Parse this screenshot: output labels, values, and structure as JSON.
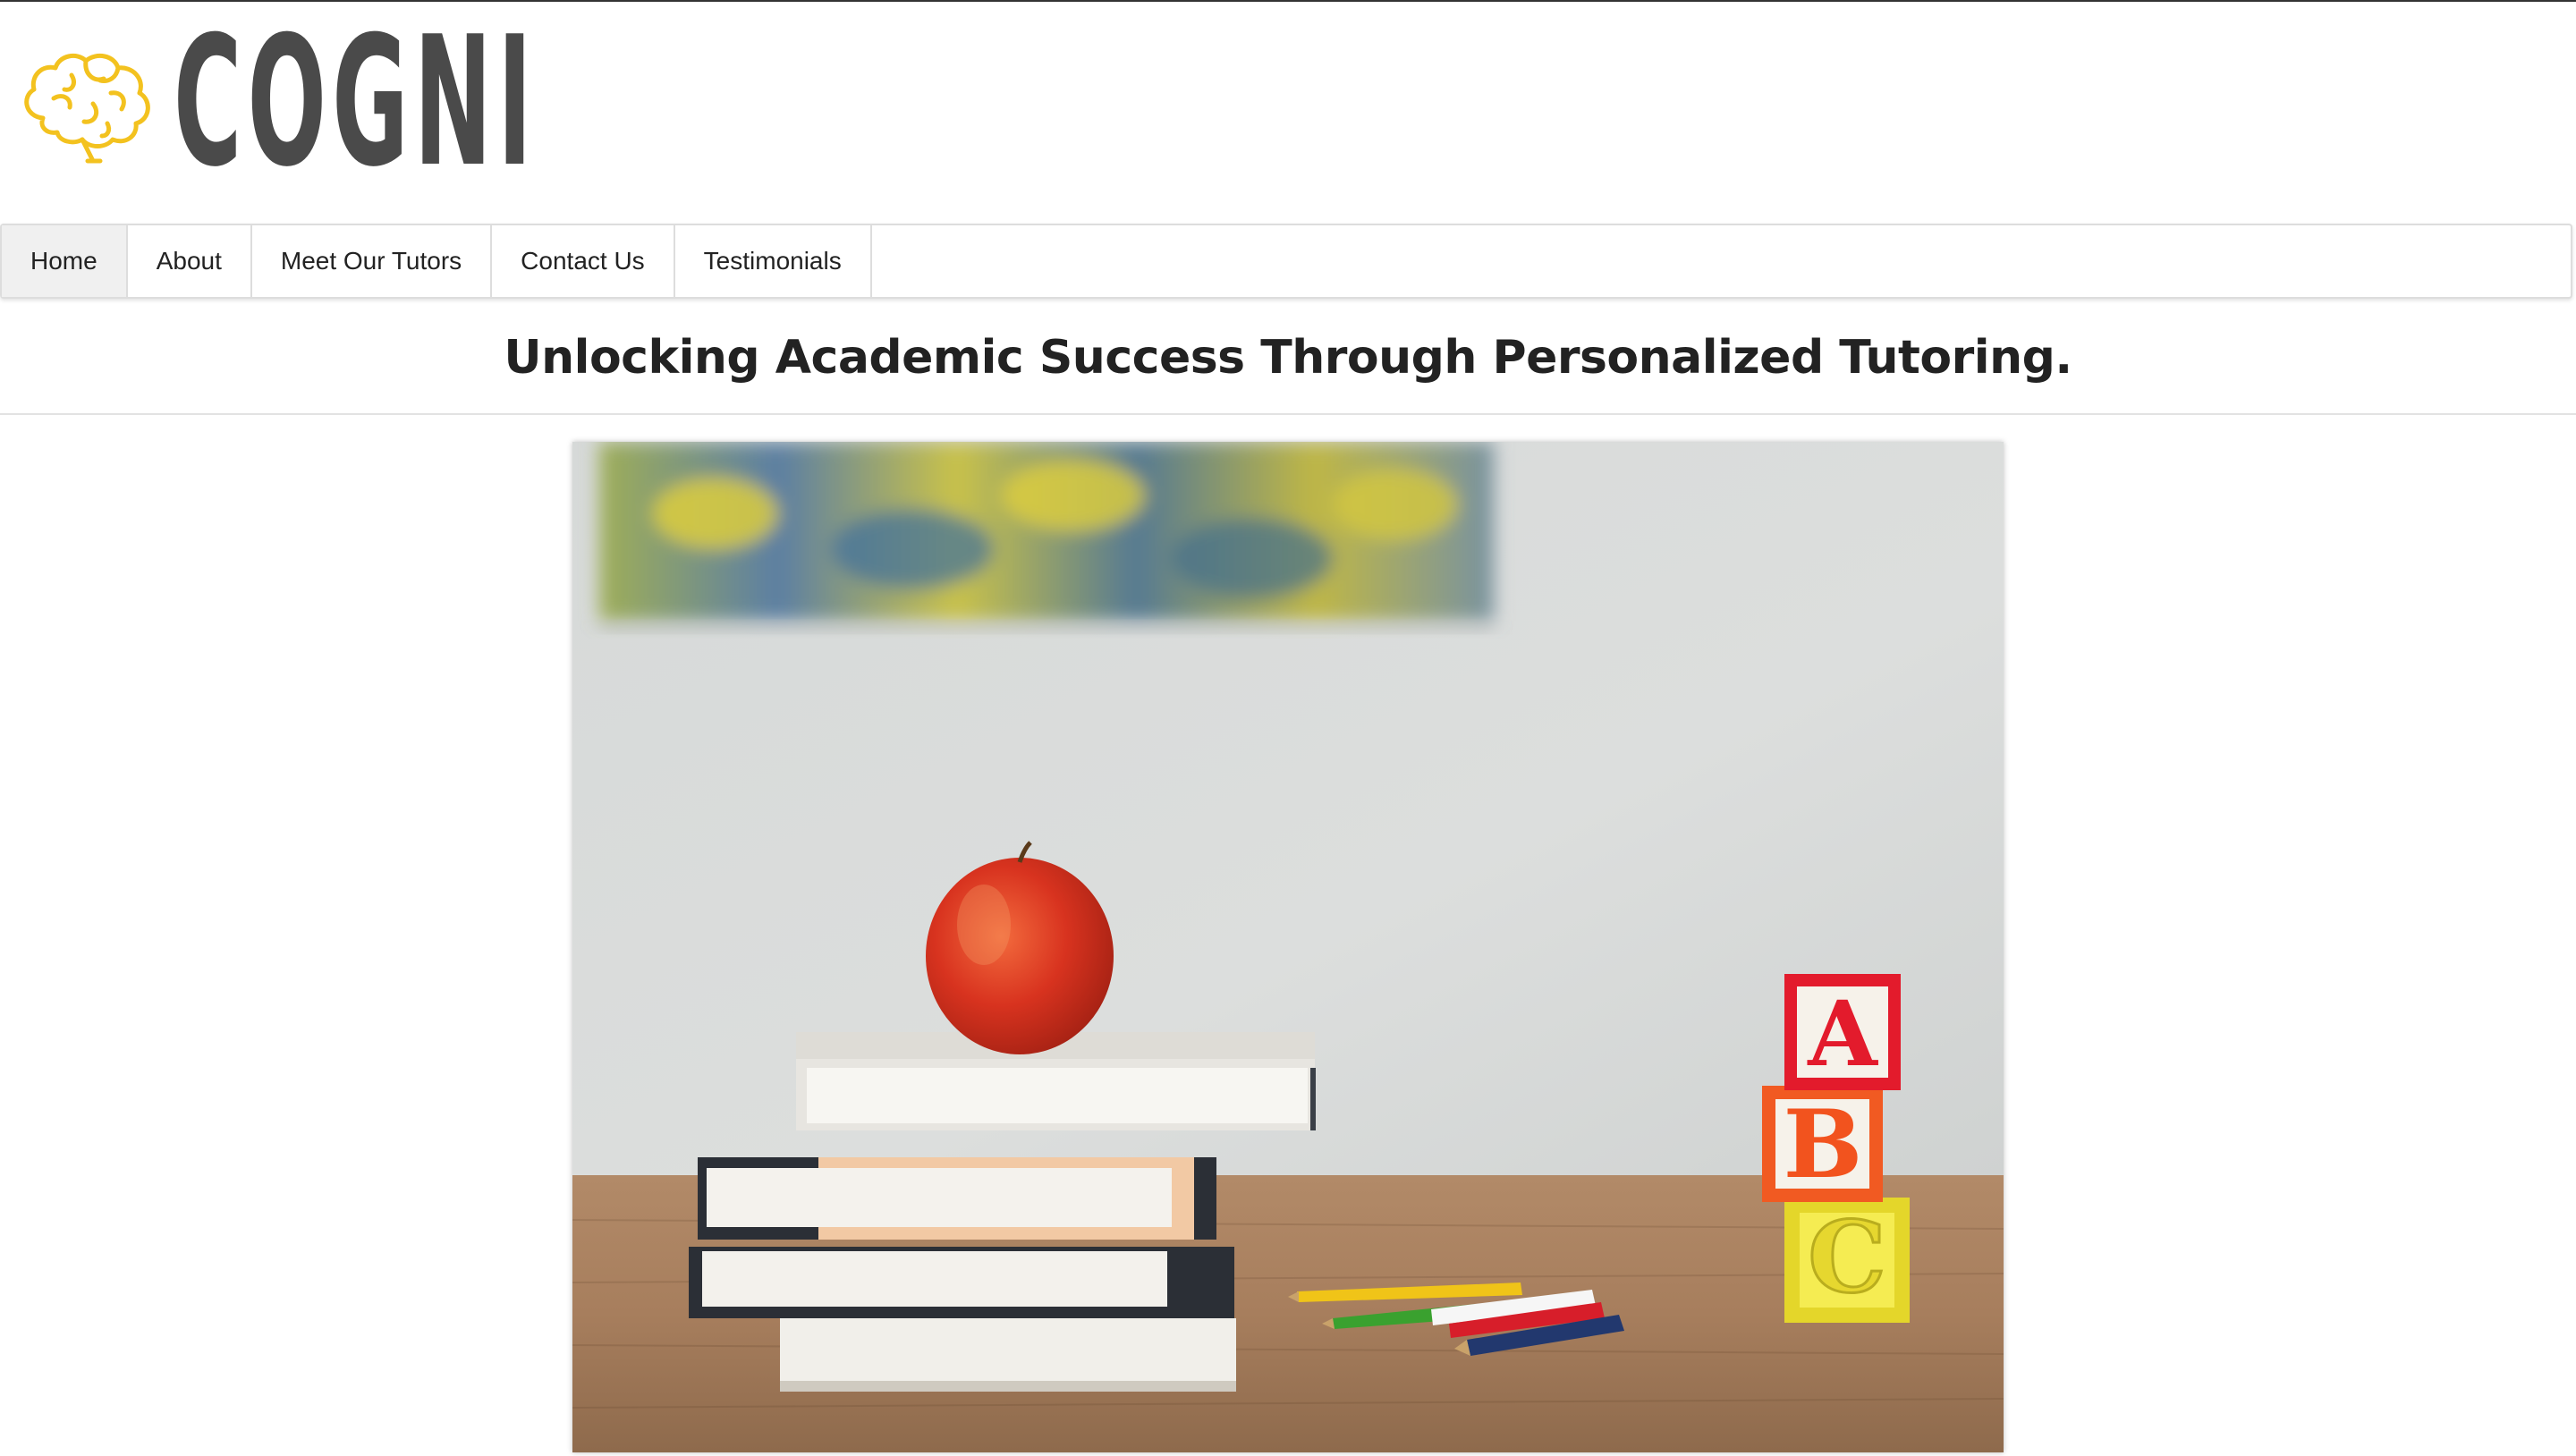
{
  "brand": {
    "name": "COGNI",
    "logo_icon": "brain-icon",
    "logo_color": "#f3c21f"
  },
  "nav": {
    "items": [
      {
        "label": "Home",
        "active": true
      },
      {
        "label": "About",
        "active": false
      },
      {
        "label": "Meet Our Tutors",
        "active": false
      },
      {
        "label": "Contact Us",
        "active": false
      },
      {
        "label": "Testimonials",
        "active": false
      }
    ]
  },
  "hero": {
    "headline": "Unlocking Academic Success Through Personalized Tutoring.",
    "image_blocks": [
      "A",
      "B",
      "C"
    ]
  }
}
